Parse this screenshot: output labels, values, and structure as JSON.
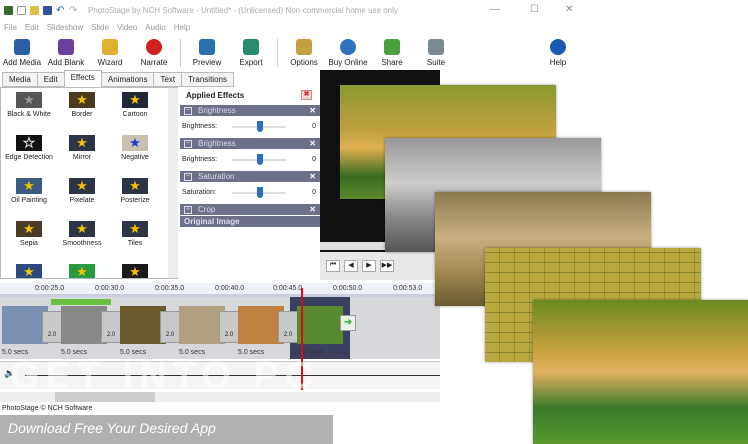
{
  "window": {
    "title": "PhotoStage by NCH Software - Untitled* - (Unlicensed) Non-commercial home use only",
    "minimize": "—",
    "maximize": "☐",
    "close": "✕"
  },
  "menu": [
    "File",
    "Edit",
    "Slideshow",
    "Slide",
    "Video",
    "Audio",
    "Help"
  ],
  "toolbar": [
    {
      "label": "Add Media",
      "color": "#2a5ea8"
    },
    {
      "label": "Add Blank",
      "color": "#6a3fa0"
    },
    {
      "label": "Wizard",
      "color": "#e0b030"
    },
    {
      "label": "Narrate",
      "color": "#d02020"
    },
    {
      "label": "Preview",
      "color": "#2a6fb0"
    },
    {
      "label": "Export",
      "color": "#2a8a70"
    },
    {
      "label": "Options",
      "color": "#c0a040"
    },
    {
      "label": "Buy Online",
      "color": "#3070c0"
    },
    {
      "label": "Share",
      "color": "#4aa040"
    },
    {
      "label": "Suite",
      "color": "#7a8a90"
    },
    {
      "label": "Help",
      "color": "#1a5ab0"
    }
  ],
  "tabs": [
    "Media",
    "Edit",
    "Effects",
    "Animations",
    "Text",
    "Transitions"
  ],
  "active_tab": "Effects",
  "effects": [
    "Black & White",
    "Border",
    "Cartoon",
    "Edge Detection",
    "Mirror",
    "Negative",
    "Oil Painting",
    "Pixelate",
    "Posterize",
    "Sepia",
    "Smoothness",
    "Tiles"
  ],
  "applied": {
    "title": "Applied Effects",
    "items": [
      {
        "name": "Brightness",
        "param": "Brightness:",
        "value": "0"
      },
      {
        "name": "Brightness",
        "param": "Brightness:",
        "value": "0"
      },
      {
        "name": "Saturation",
        "param": "Saturation:",
        "value": "0"
      }
    ],
    "crop": "Crop",
    "original": "Original Image"
  },
  "timeline": {
    "ticks": [
      "0:00:25.0",
      "0:00:30.0",
      "0:00:35.0",
      "0:00:40.0",
      "0:00:45.0",
      "0:00:50.0",
      "0:00:53.0"
    ],
    "transition": "2.0",
    "duration": "5.0 secs"
  },
  "status": "PhotoStage © NCH Software",
  "watermark": "GET INTO PC",
  "banner": "Download Free Your Desired App",
  "colors": {
    "header": "#6c7088",
    "playhead": "#d01010",
    "accent": "#2a6fc0"
  }
}
